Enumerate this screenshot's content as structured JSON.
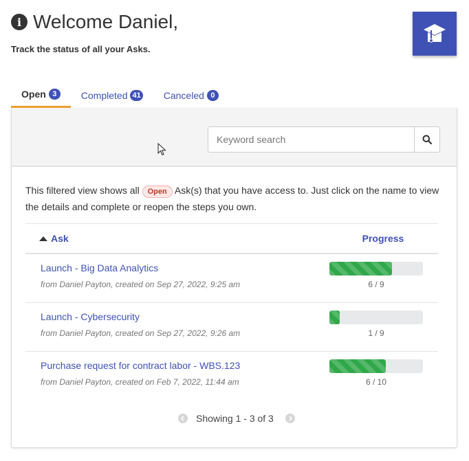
{
  "header": {
    "title": "Welcome Daniel,",
    "subtitle": "Track the status of all your Asks."
  },
  "tabs": [
    {
      "label": "Open",
      "count": "3"
    },
    {
      "label": "Completed",
      "count": "41"
    },
    {
      "label": "Canceled",
      "count": "0"
    }
  ],
  "search": {
    "placeholder": "Keyword search"
  },
  "description": {
    "before": "This filtered view shows all",
    "pill": "Open",
    "after": "Ask(s) that you have access to. Just click on the name to view the details and complete or reopen the steps you own."
  },
  "table": {
    "headers": {
      "ask": "Ask",
      "progress": "Progress"
    },
    "rows": [
      {
        "name": "Launch - Big Data Analytics",
        "meta": "from Daniel Payton, created on Sep 27, 2022, 9:25 am",
        "progress_label": "6 / 9",
        "progress": 0.667
      },
      {
        "name": "Launch - Cybersecurity",
        "meta": "from Daniel Payton, created on Sep 27, 2022, 9:26 am",
        "progress_label": "1 / 9",
        "progress": 0.111
      },
      {
        "name": "Purchase request for contract labor - WBS.123",
        "meta": "from Daniel Payton, created on Feb 7, 2022, 11:44 am",
        "progress_label": "6 / 10",
        "progress": 0.6
      }
    ]
  },
  "pagination": {
    "label": "Showing 1 - 3 of 3"
  },
  "colors": {
    "accent": "#3f51b5",
    "active_tab": "#f0a030",
    "progress": "#30a84a"
  }
}
